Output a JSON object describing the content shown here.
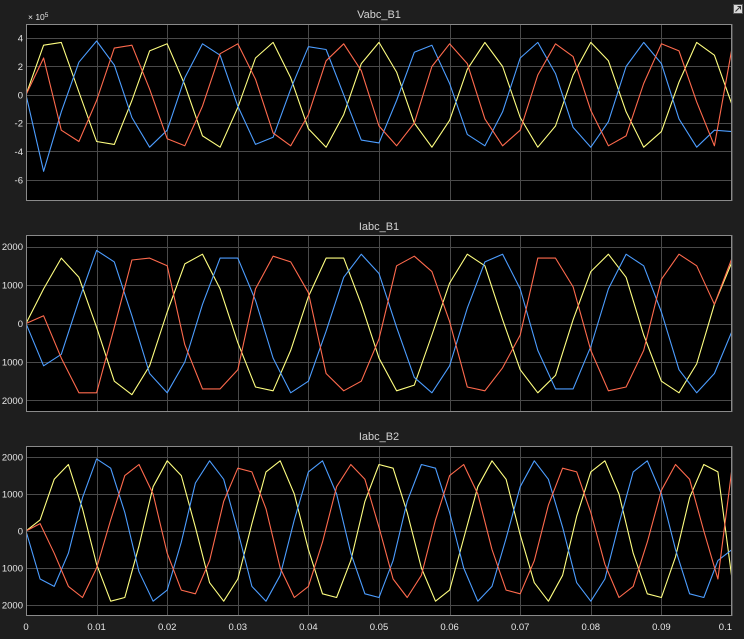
{
  "window": {
    "undock_icon": "undock-icon"
  },
  "colors": {
    "figure_bg": "#1e1e1e",
    "axes_bg": "#000000",
    "grid": "#4a4a4a",
    "axes_border": "#8a8a8a",
    "tick_text": "#e6e6e6",
    "title_text": "#d2d2d2",
    "phase_a": "#ffff80",
    "phase_b": "#4c9dff",
    "phase_c": "#ff6a4d"
  },
  "x_axis": {
    "ticks": [
      0,
      0.01,
      0.02,
      0.03,
      0.04,
      0.05,
      0.06,
      0.07,
      0.08,
      0.09,
      0.1
    ],
    "tick_labels": [
      "0",
      "0.01",
      "0.02",
      "0.03",
      "0.04",
      "0.05",
      "0.06",
      "0.07",
      "0.08",
      "0.09",
      "0.1"
    ],
    "xlim": [
      0,
      0.1
    ]
  },
  "chart_data": [
    {
      "type": "line",
      "title": "Vabc_B1",
      "exponent_label": "× 10",
      "exponent_power": "5",
      "xlim": [
        0,
        0.1
      ],
      "ylim": [
        -7.5,
        5
      ],
      "yticks": [
        4,
        2,
        0,
        -2,
        -4,
        -6
      ],
      "ytick_labels": [
        "4",
        "2",
        "0",
        "-2",
        "-4",
        "-6"
      ],
      "grid": true,
      "series": [
        {
          "color": "#ffff80",
          "x": [
            0,
            0.0025,
            0.005,
            0.0075,
            0.01,
            0.0125,
            0.015,
            0.0175,
            0.02,
            0.0225,
            0.025,
            0.0275,
            0.03,
            0.0325,
            0.035,
            0.0375,
            0.04,
            0.0425,
            0.045,
            0.0475,
            0.05,
            0.0525,
            0.055,
            0.0575,
            0.06,
            0.0625,
            0.065,
            0.0675,
            0.07,
            0.0725,
            0.075,
            0.0775,
            0.08,
            0.0825,
            0.085,
            0.0875,
            0.09,
            0.0925,
            0.095,
            0.0975,
            0.1
          ],
          "y": [
            0,
            3.5,
            3.7,
            0.2,
            -3.3,
            -3.5,
            -0.4,
            3.1,
            3.6,
            0.7,
            -2.9,
            -3.7,
            -0.9,
            2.6,
            3.7,
            1.2,
            -2.4,
            -3.7,
            -1.4,
            2.2,
            3.7,
            1.6,
            -2.0,
            -3.7,
            -1.8,
            1.8,
            3.7,
            2.0,
            -1.6,
            -3.7,
            -2.2,
            1.4,
            3.7,
            2.4,
            -1.2,
            -3.7,
            -2.6,
            0.9,
            3.7,
            2.8,
            -0.7
          ]
        },
        {
          "color": "#4c9dff",
          "x": [
            0,
            0.0025,
            0.005,
            0.0075,
            0.01,
            0.0125,
            0.015,
            0.0175,
            0.02,
            0.0225,
            0.025,
            0.0275,
            0.03,
            0.0325,
            0.035,
            0.0375,
            0.04,
            0.0425,
            0.045,
            0.0475,
            0.05,
            0.0525,
            0.055,
            0.0575,
            0.06,
            0.0625,
            0.065,
            0.0675,
            0.07,
            0.0725,
            0.075,
            0.0775,
            0.08,
            0.0825,
            0.085,
            0.0875,
            0.09,
            0.0925,
            0.095,
            0.0975,
            0.1
          ],
          "y": [
            0,
            -5.4,
            -1.2,
            2.3,
            3.8,
            2.1,
            -1.6,
            -3.7,
            -2.5,
            1.2,
            3.6,
            2.8,
            -0.8,
            -3.5,
            -3.0,
            0.4,
            3.4,
            3.2,
            0,
            -3.2,
            -3.4,
            -0.4,
            3.0,
            3.5,
            0.8,
            -2.8,
            -3.6,
            -1.2,
            2.6,
            3.7,
            1.5,
            -2.3,
            -3.7,
            -1.9,
            2.0,
            3.7,
            2.2,
            -1.7,
            -3.7,
            -2.5,
            -2.6
          ]
        },
        {
          "color": "#ff6a4d",
          "x": [
            0,
            0.0025,
            0.005,
            0.0075,
            0.01,
            0.0125,
            0.015,
            0.0175,
            0.02,
            0.0225,
            0.025,
            0.0275,
            0.03,
            0.0325,
            0.035,
            0.0375,
            0.04,
            0.0425,
            0.045,
            0.0475,
            0.05,
            0.0525,
            0.055,
            0.0575,
            0.06,
            0.0625,
            0.065,
            0.0675,
            0.07,
            0.0725,
            0.075,
            0.0775,
            0.08,
            0.0825,
            0.085,
            0.0875,
            0.09,
            0.0925,
            0.095,
            0.0975,
            0.1
          ],
          "y": [
            0,
            2.6,
            -2.5,
            -3.3,
            -0.4,
            3.3,
            3.5,
            0.4,
            -3.1,
            -3.6,
            -0.8,
            2.9,
            3.6,
            1.1,
            -2.7,
            -3.6,
            -1.4,
            2.4,
            3.6,
            1.7,
            -2.2,
            -3.6,
            -2.0,
            2.0,
            3.6,
            2.2,
            -1.7,
            -3.6,
            -2.5,
            1.4,
            3.6,
            2.7,
            -1.1,
            -3.6,
            -2.9,
            0.8,
            3.6,
            3.1,
            -0.5,
            -3.6,
            3.3
          ]
        }
      ]
    },
    {
      "type": "line",
      "title": "Iabc_B1",
      "xlim": [
        0,
        0.1
      ],
      "ylim": [
        -2300,
        2300
      ],
      "yticks": [
        2000,
        1000,
        0,
        -1000,
        -2000
      ],
      "ytick_labels": [
        "2000",
        "1000",
        "0",
        "1000",
        "2000"
      ],
      "grid": true,
      "series": [
        {
          "color": "#ffff80",
          "x": [
            0,
            0.0025,
            0.005,
            0.0075,
            0.01,
            0.0125,
            0.015,
            0.0175,
            0.02,
            0.0225,
            0.025,
            0.0275,
            0.03,
            0.0325,
            0.035,
            0.0375,
            0.04,
            0.0425,
            0.045,
            0.0475,
            0.05,
            0.0525,
            0.055,
            0.0575,
            0.06,
            0.0625,
            0.065,
            0.0675,
            0.07,
            0.0725,
            0.075,
            0.0775,
            0.08,
            0.0825,
            0.085,
            0.0875,
            0.09,
            0.0925,
            0.095,
            0.0975,
            0.1
          ],
          "y": [
            0,
            900,
            1700,
            1200,
            -100,
            -1500,
            -1850,
            -1100,
            300,
            1550,
            1800,
            900,
            -500,
            -1650,
            -1750,
            -700,
            700,
            1700,
            1700,
            500,
            -900,
            -1750,
            -1600,
            -300,
            1050,
            1800,
            1500,
            100,
            -1200,
            -1800,
            -1350,
            100,
            1350,
            1800,
            1200,
            -300,
            -1500,
            -1800,
            -1050,
            500,
            1600
          ]
        },
        {
          "color": "#4c9dff",
          "x": [
            0,
            0.0025,
            0.005,
            0.0075,
            0.01,
            0.0125,
            0.015,
            0.0175,
            0.02,
            0.0225,
            0.025,
            0.0275,
            0.03,
            0.0325,
            0.035,
            0.0375,
            0.04,
            0.0425,
            0.045,
            0.0475,
            0.05,
            0.0525,
            0.055,
            0.0575,
            0.06,
            0.0625,
            0.065,
            0.0675,
            0.07,
            0.0725,
            0.075,
            0.0775,
            0.08,
            0.0825,
            0.085,
            0.0875,
            0.09,
            0.0925,
            0.095,
            0.0975,
            0.1
          ],
          "y": [
            0,
            -1100,
            -800,
            600,
            1900,
            1600,
            200,
            -1300,
            -1800,
            -1000,
            500,
            1700,
            1700,
            600,
            -900,
            -1800,
            -1500,
            -200,
            1200,
            1800,
            1300,
            -100,
            -1400,
            -1800,
            -1100,
            400,
            1600,
            1800,
            900,
            -700,
            -1700,
            -1700,
            -600,
            900,
            1800,
            1500,
            300,
            -1200,
            -1800,
            -1300,
            -200
          ]
        },
        {
          "color": "#ff6a4d",
          "x": [
            0,
            0.0025,
            0.005,
            0.0075,
            0.01,
            0.0125,
            0.015,
            0.0175,
            0.02,
            0.0225,
            0.025,
            0.0275,
            0.03,
            0.0325,
            0.035,
            0.0375,
            0.04,
            0.0425,
            0.045,
            0.0475,
            0.05,
            0.0525,
            0.055,
            0.0575,
            0.06,
            0.0625,
            0.065,
            0.0675,
            0.07,
            0.0725,
            0.075,
            0.0775,
            0.08,
            0.0825,
            0.085,
            0.0875,
            0.09,
            0.0925,
            0.095,
            0.0975,
            0.1
          ],
          "y": [
            0,
            200,
            -900,
            -1800,
            -1800,
            -100,
            1650,
            1700,
            1500,
            -550,
            -1700,
            -1700,
            -1200,
            900,
            1750,
            1600,
            800,
            -1300,
            -1750,
            -1500,
            -400,
            1500,
            1750,
            1350,
            50,
            -1650,
            -1750,
            -1150,
            -300,
            1700,
            1700,
            950,
            -700,
            -1750,
            -1650,
            -700,
            1150,
            1800,
            1500,
            500,
            1700
          ]
        }
      ]
    },
    {
      "type": "line",
      "title": "Iabc_B2",
      "xlim": [
        0,
        0.1
      ],
      "ylim": [
        -2300,
        2300
      ],
      "yticks": [
        2000,
        1000,
        0,
        -1000,
        -2000
      ],
      "ytick_labels": [
        "2000",
        "1000",
        "0",
        "1000",
        "2000"
      ],
      "grid": true,
      "series": [
        {
          "color": "#ffff80",
          "x": [
            0,
            0.002,
            0.004,
            0.006,
            0.008,
            0.01,
            0.012,
            0.014,
            0.016,
            0.018,
            0.02,
            0.022,
            0.024,
            0.026,
            0.028,
            0.03,
            0.032,
            0.034,
            0.036,
            0.038,
            0.04,
            0.042,
            0.044,
            0.046,
            0.048,
            0.05,
            0.052,
            0.054,
            0.056,
            0.058,
            0.06,
            0.062,
            0.064,
            0.066,
            0.068,
            0.07,
            0.072,
            0.074,
            0.076,
            0.078,
            0.08,
            0.082,
            0.084,
            0.086,
            0.088,
            0.09,
            0.092,
            0.094,
            0.096,
            0.098,
            0.1
          ],
          "y": [
            0,
            300,
            1400,
            1800,
            600,
            -900,
            -1900,
            -1800,
            -400,
            1200,
            1900,
            1500,
            100,
            -1400,
            -1900,
            -1300,
            200,
            1600,
            1900,
            1000,
            -500,
            -1700,
            -1800,
            -800,
            800,
            1800,
            1700,
            500,
            -1000,
            -1900,
            -1600,
            -200,
            1200,
            1900,
            1400,
            -100,
            -1400,
            -1900,
            -1200,
            400,
            1600,
            1900,
            1000,
            -600,
            -1700,
            -1800,
            -700,
            900,
            1800,
            1600,
            -1300
          ]
        },
        {
          "color": "#4c9dff",
          "x": [
            0,
            0.002,
            0.004,
            0.006,
            0.008,
            0.01,
            0.012,
            0.014,
            0.016,
            0.018,
            0.02,
            0.022,
            0.024,
            0.026,
            0.028,
            0.03,
            0.032,
            0.034,
            0.036,
            0.038,
            0.04,
            0.042,
            0.044,
            0.046,
            0.048,
            0.05,
            0.052,
            0.054,
            0.056,
            0.058,
            0.06,
            0.062,
            0.064,
            0.066,
            0.068,
            0.07,
            0.072,
            0.074,
            0.076,
            0.078,
            0.08,
            0.082,
            0.084,
            0.086,
            0.088,
            0.09,
            0.092,
            0.094,
            0.096,
            0.098,
            0.1
          ],
          "y": [
            0,
            -1300,
            -1500,
            -600,
            900,
            1950,
            1700,
            500,
            -1100,
            -1900,
            -1600,
            -300,
            1300,
            1900,
            1400,
            0,
            -1500,
            -1900,
            -1200,
            300,
            1600,
            1900,
            1000,
            -600,
            -1700,
            -1800,
            -800,
            800,
            1800,
            1700,
            500,
            -1000,
            -1900,
            -1500,
            -200,
            1200,
            1900,
            1400,
            100,
            -1400,
            -1900,
            -1300,
            200,
            1600,
            1900,
            1000,
            -500,
            -1700,
            -1800,
            -800,
            -500
          ]
        },
        {
          "color": "#ff6a4d",
          "x": [
            0,
            0.002,
            0.004,
            0.006,
            0.008,
            0.01,
            0.012,
            0.014,
            0.016,
            0.018,
            0.02,
            0.022,
            0.024,
            0.026,
            0.028,
            0.03,
            0.032,
            0.034,
            0.036,
            0.038,
            0.04,
            0.042,
            0.044,
            0.046,
            0.048,
            0.05,
            0.052,
            0.054,
            0.056,
            0.058,
            0.06,
            0.062,
            0.064,
            0.066,
            0.068,
            0.07,
            0.072,
            0.074,
            0.076,
            0.078,
            0.08,
            0.082,
            0.084,
            0.086,
            0.088,
            0.09,
            0.092,
            0.094,
            0.096,
            0.098,
            0.1
          ],
          "y": [
            0,
            200,
            -600,
            -1500,
            -1800,
            -1000,
            300,
            1500,
            1800,
            1000,
            -600,
            -1600,
            -1700,
            -800,
            800,
            1700,
            1600,
            600,
            -1000,
            -1800,
            -1500,
            -300,
            1200,
            1800,
            1400,
            100,
            -1300,
            -1800,
            -1200,
            300,
            1500,
            1800,
            1000,
            -500,
            -1600,
            -1700,
            -800,
            700,
            1700,
            1600,
            500,
            -900,
            -1800,
            -1500,
            -300,
            1100,
            1800,
            1400,
            0,
            -1300,
            1700
          ]
        }
      ]
    }
  ]
}
